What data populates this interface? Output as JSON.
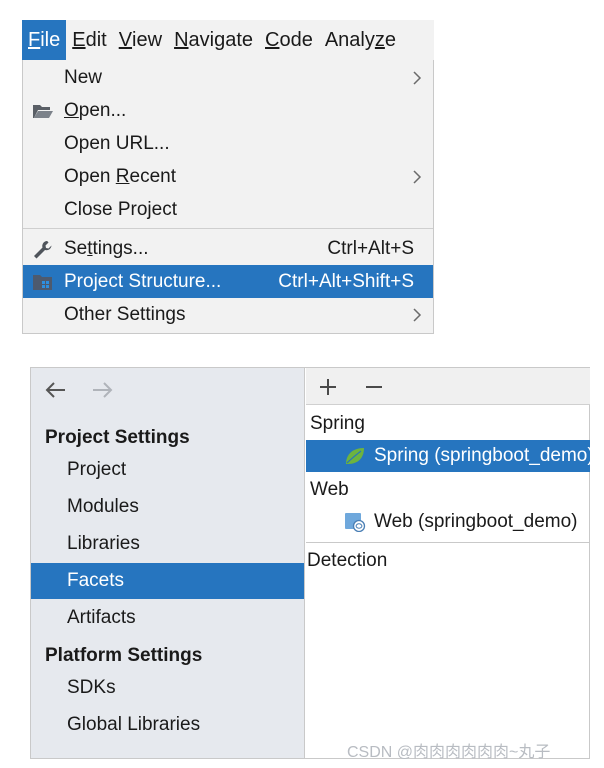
{
  "menubar": {
    "items": [
      {
        "mnemonic": "F",
        "rest": "ile"
      },
      {
        "mnemonic": "E",
        "rest": "dit"
      },
      {
        "mnemonic": "V",
        "rest": "iew"
      },
      {
        "mnemonic": "N",
        "rest": "avigate"
      },
      {
        "mnemonic": "C",
        "rest": "ode"
      },
      {
        "before": "Analy",
        "mnemonic": "z",
        "rest": "e"
      }
    ]
  },
  "file_menu": {
    "new": {
      "label": "New"
    },
    "open": {
      "mnemonic": "O",
      "rest": "pen..."
    },
    "open_url": {
      "label": "Open URL..."
    },
    "open_recent": {
      "before": "Open ",
      "mnemonic": "R",
      "rest": "ecent"
    },
    "close_project": {
      "label": "Close Project"
    },
    "settings": {
      "before": "Se",
      "mnemonic": "t",
      "rest": "tings...",
      "shortcut": "Ctrl+Alt+S"
    },
    "project_structure": {
      "label": "Project Structure...",
      "shortcut": "Ctrl+Alt+Shift+S"
    },
    "other_settings": {
      "label": "Other Settings"
    }
  },
  "dialog": {
    "sidebar": {
      "project_settings_heading": "Project Settings",
      "project_settings_items": [
        "Project",
        "Modules",
        "Libraries",
        "Facets",
        "Artifacts"
      ],
      "platform_settings_heading": "Platform Settings",
      "platform_settings_items": [
        "SDKs",
        "Global Libraries"
      ],
      "selected": "Facets"
    },
    "facets": {
      "spring_group": "Spring",
      "spring_item": "Spring (springboot_demo)",
      "web_group": "Web",
      "web_item": "Web (springboot_demo)",
      "detection_label": "Detection"
    }
  },
  "watermark": "CSDN @肉肉肉肉肉肉~丸子",
  "colors": {
    "selection": "#2675bf",
    "menu_background": "#f2f2f2",
    "sidebar_background": "#e6e9ee",
    "spring_leaf": "#6db33f"
  },
  "icons": {
    "open": "folder-open-icon",
    "settings": "wrench-icon",
    "project_structure": "project-structure-icon",
    "submenu": "chevron-right-icon",
    "back": "arrow-left-icon",
    "forward": "arrow-right-icon",
    "add": "plus-icon",
    "remove": "minus-icon",
    "spring_facet": "spring-leaf-icon",
    "web_facet": "web-facet-icon"
  }
}
